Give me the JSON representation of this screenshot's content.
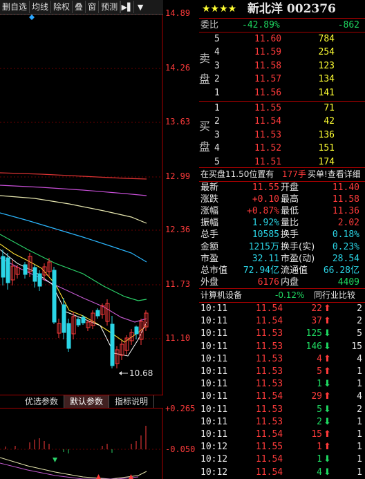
{
  "toolbar": {
    "buttons": [
      "删自选",
      "均线",
      "除权",
      "叠",
      "窗",
      "预测"
    ]
  },
  "chart": {
    "price_ticks": [
      "14.89",
      "14.26",
      "13.63",
      "12.99",
      "12.36",
      "11.73",
      "11.10"
    ],
    "low_marker": "10.68",
    "indicator_ticks": [
      "+0.265",
      "-0.050"
    ]
  },
  "param_tabs": [
    "优选参数",
    "默认参数",
    "指标说明"
  ],
  "quote": {
    "title": "新北洋 002376",
    "stars": "★★★★",
    "weibi_label": "委比",
    "weibi_pct": "-42.89%",
    "weibi_diff": "-862",
    "sell_label": "卖盘",
    "buy_label": "买盘",
    "sell": [
      {
        "lvl": "5",
        "price": "11.60",
        "vol": "784"
      },
      {
        "lvl": "4",
        "price": "11.59",
        "vol": "254"
      },
      {
        "lvl": "3",
        "price": "11.58",
        "vol": "123"
      },
      {
        "lvl": "2",
        "price": "11.57",
        "vol": "134"
      },
      {
        "lvl": "1",
        "price": "11.56",
        "vol": "141"
      }
    ],
    "buy": [
      {
        "lvl": "1",
        "price": "11.55",
        "vol": "71"
      },
      {
        "lvl": "2",
        "price": "11.54",
        "vol": "42"
      },
      {
        "lvl": "3",
        "price": "11.53",
        "vol": "136"
      },
      {
        "lvl": "4",
        "price": "11.52",
        "vol": "151"
      },
      {
        "lvl": "5",
        "price": "11.51",
        "vol": "174"
      }
    ],
    "notice_left": "在买盘11.50位置有",
    "notice_vol": "177手",
    "notice_right": "买单!查看详细",
    "stats": [
      {
        "l1": "最新",
        "v1": "11.55",
        "l2": "开盘",
        "v2": "11.40"
      },
      {
        "l1": "涨跌",
        "v1": "+0.10",
        "l2": "最高",
        "v2": "11.58"
      },
      {
        "l1": "涨幅",
        "v1": "+0.87%",
        "l2": "最低",
        "v2": "11.36"
      },
      {
        "l1": "振幅",
        "v1": "1.92%",
        "l2": "量比",
        "v2": "2.02"
      },
      {
        "l1": "总手",
        "v1": "10585",
        "l2": "换手",
        "v2": "0.18%"
      },
      {
        "l1": "金额",
        "v1": "1215万",
        "l2": "换手(实)",
        "v2": "0.23%"
      },
      {
        "l1": "市盈",
        "v1": "32.11",
        "l2": "市盈(动)",
        "v2": "28.54"
      },
      {
        "l1": "总市值",
        "v1": "72.94亿",
        "l2": "流通值",
        "v2": "66.28亿"
      },
      {
        "l1": "外盘",
        "v1": "6176",
        "l2": "内盘",
        "v2": "4409"
      }
    ],
    "sector_name": "计算机设备",
    "sector_pct": "-0.12%",
    "compare_label": "同行业比较"
  },
  "ticks": [
    {
      "t": "10:11",
      "p": "11.54",
      "v": "22",
      "d": "up",
      "n": "2"
    },
    {
      "t": "10:11",
      "p": "11.54",
      "v": "37",
      "d": "up",
      "n": "2"
    },
    {
      "t": "10:11",
      "p": "11.53",
      "v": "125",
      "d": "down",
      "n": "5"
    },
    {
      "t": "10:11",
      "p": "11.53",
      "v": "146",
      "d": "down",
      "n": "15"
    },
    {
      "t": "10:11",
      "p": "11.53",
      "v": "4",
      "d": "up",
      "n": "4"
    },
    {
      "t": "10:11",
      "p": "11.53",
      "v": "5",
      "d": "up",
      "n": "1"
    },
    {
      "t": "10:11",
      "p": "11.53",
      "v": "1",
      "d": "down",
      "n": "1"
    },
    {
      "t": "10:11",
      "p": "11.54",
      "v": "29",
      "d": "up",
      "n": "4"
    },
    {
      "t": "10:11",
      "p": "11.53",
      "v": "5",
      "d": "down",
      "n": "2"
    },
    {
      "t": "10:11",
      "p": "11.53",
      "v": "2",
      "d": "down",
      "n": "1"
    },
    {
      "t": "10:11",
      "p": "11.54",
      "v": "15",
      "d": "up",
      "n": "1"
    },
    {
      "t": "10:12",
      "p": "11.55",
      "v": "1",
      "d": "up",
      "n": "1"
    },
    {
      "t": "10:12",
      "p": "11.54",
      "v": "1",
      "d": "down",
      "n": "1"
    },
    {
      "t": "10:12",
      "p": "11.54",
      "v": "4",
      "d": "down",
      "n": "1"
    }
  ]
}
